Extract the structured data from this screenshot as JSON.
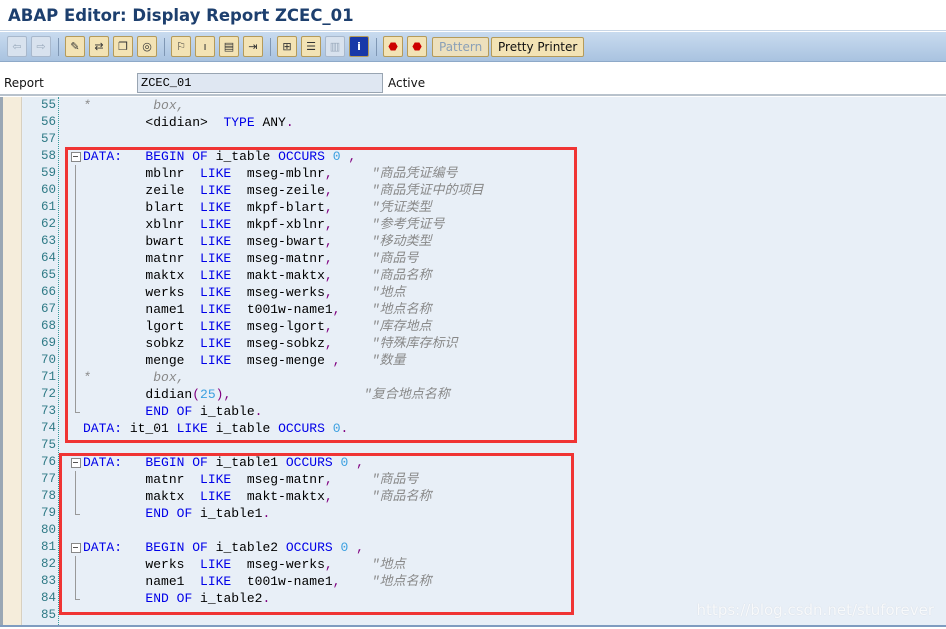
{
  "window": {
    "title": "ABAP Editor: Display Report ZCEC_01"
  },
  "toolbar": {
    "icons": [
      "back-icon",
      "forward-icon",
      "edit-toggle-icon",
      "active-inactive-icon",
      "other-object-icon",
      "check-icon",
      "activate-icon",
      "where-used-icon",
      "display-object-list-icon",
      "navigation-window-icon",
      "hierarchy-icon",
      "enhance-icon",
      "split-screen-icon",
      "info-icon",
      "set-breakpoint-icon",
      "set-session-breakpoint-icon"
    ],
    "pattern_label": "Pattern",
    "pretty_printer_label": "Pretty Printer"
  },
  "report": {
    "label": "Report",
    "value": "ZCEC_01",
    "status": "Active"
  },
  "editor": {
    "lines": [
      {
        "n": "55",
        "f": "",
        "t": [
          [
            "s",
            "*        box,"
          ]
        ]
      },
      {
        "n": "56",
        "f": "",
        "t": [
          [
            "i",
            "        <didian>  "
          ],
          [
            "k",
            "TYPE"
          ],
          [
            "i",
            " ANY"
          ],
          [
            "p",
            "."
          ]
        ]
      },
      {
        "n": "57",
        "f": "",
        "t": []
      },
      {
        "n": "58",
        "f": "open",
        "t": [
          [
            "k",
            "DATA:"
          ],
          [
            "i",
            "   "
          ],
          [
            "k",
            "BEGIN"
          ],
          [
            "i",
            " "
          ],
          [
            "k",
            "OF"
          ],
          [
            "i",
            " i_table "
          ],
          [
            "k",
            "OCCURS"
          ],
          [
            "i",
            " "
          ],
          [
            "n",
            "0"
          ],
          [
            "i",
            " "
          ],
          [
            "p",
            ","
          ]
        ]
      },
      {
        "n": "59",
        "f": "bar",
        "t": [
          [
            "i",
            "        mblnr  "
          ],
          [
            "k",
            "LIKE"
          ],
          [
            "i",
            "  mseg-mblnr"
          ],
          [
            "p",
            ","
          ],
          [
            "i",
            "     "
          ],
          [
            "c",
            "\"商品凭证编号"
          ]
        ]
      },
      {
        "n": "60",
        "f": "bar",
        "t": [
          [
            "i",
            "        zeile  "
          ],
          [
            "k",
            "LIKE"
          ],
          [
            "i",
            "  mseg-zeile"
          ],
          [
            "p",
            ","
          ],
          [
            "i",
            "     "
          ],
          [
            "c",
            "\"商品凭证中的项目"
          ]
        ]
      },
      {
        "n": "61",
        "f": "bar",
        "t": [
          [
            "i",
            "        blart  "
          ],
          [
            "k",
            "LIKE"
          ],
          [
            "i",
            "  mkpf-blart"
          ],
          [
            "p",
            ","
          ],
          [
            "i",
            "     "
          ],
          [
            "c",
            "\"凭证类型"
          ]
        ]
      },
      {
        "n": "62",
        "f": "bar",
        "t": [
          [
            "i",
            "        xblnr  "
          ],
          [
            "k",
            "LIKE"
          ],
          [
            "i",
            "  mkpf-xblnr"
          ],
          [
            "p",
            ","
          ],
          [
            "i",
            "     "
          ],
          [
            "c",
            "\"参考凭证号"
          ]
        ]
      },
      {
        "n": "63",
        "f": "bar",
        "t": [
          [
            "i",
            "        bwart  "
          ],
          [
            "k",
            "LIKE"
          ],
          [
            "i",
            "  mseg-bwart"
          ],
          [
            "p",
            ","
          ],
          [
            "i",
            "     "
          ],
          [
            "c",
            "\"移动类型"
          ]
        ]
      },
      {
        "n": "64",
        "f": "bar",
        "t": [
          [
            "i",
            "        matnr  "
          ],
          [
            "k",
            "LIKE"
          ],
          [
            "i",
            "  mseg-matnr"
          ],
          [
            "p",
            ","
          ],
          [
            "i",
            "     "
          ],
          [
            "c",
            "\"商品号"
          ]
        ]
      },
      {
        "n": "65",
        "f": "bar",
        "t": [
          [
            "i",
            "        maktx  "
          ],
          [
            "k",
            "LIKE"
          ],
          [
            "i",
            "  makt-maktx"
          ],
          [
            "p",
            ","
          ],
          [
            "i",
            "     "
          ],
          [
            "c",
            "\"商品名称"
          ]
        ]
      },
      {
        "n": "66",
        "f": "bar",
        "t": [
          [
            "i",
            "        werks  "
          ],
          [
            "k",
            "LIKE"
          ],
          [
            "i",
            "  mseg-werks"
          ],
          [
            "p",
            ","
          ],
          [
            "i",
            "     "
          ],
          [
            "c",
            "\"地点"
          ]
        ]
      },
      {
        "n": "67",
        "f": "bar",
        "t": [
          [
            "i",
            "        name1  "
          ],
          [
            "k",
            "LIKE"
          ],
          [
            "i",
            "  t001w-name1"
          ],
          [
            "p",
            ","
          ],
          [
            "i",
            "    "
          ],
          [
            "c",
            "\"地点名称"
          ]
        ]
      },
      {
        "n": "68",
        "f": "bar",
        "t": [
          [
            "i",
            "        lgort  "
          ],
          [
            "k",
            "LIKE"
          ],
          [
            "i",
            "  mseg-lgort"
          ],
          [
            "p",
            ","
          ],
          [
            "i",
            "     "
          ],
          [
            "c",
            "\"库存地点"
          ]
        ]
      },
      {
        "n": "69",
        "f": "bar",
        "t": [
          [
            "i",
            "        sobkz  "
          ],
          [
            "k",
            "LIKE"
          ],
          [
            "i",
            "  mseg-sobkz"
          ],
          [
            "p",
            ","
          ],
          [
            "i",
            "     "
          ],
          [
            "c",
            "\"特殊库存标识"
          ]
        ]
      },
      {
        "n": "70",
        "f": "bar",
        "t": [
          [
            "i",
            "        menge  "
          ],
          [
            "k",
            "LIKE"
          ],
          [
            "i",
            "  mseg-menge "
          ],
          [
            "p",
            ","
          ],
          [
            "i",
            "    "
          ],
          [
            "c",
            "\"数量"
          ]
        ]
      },
      {
        "n": "71",
        "f": "bar",
        "t": [
          [
            "s",
            "*        box,"
          ]
        ]
      },
      {
        "n": "72",
        "f": "bar",
        "t": [
          [
            "i",
            "        didian"
          ],
          [
            "p",
            "("
          ],
          [
            "n",
            "25"
          ],
          [
            "p",
            ")"
          ],
          [
            "p",
            ","
          ],
          [
            "i",
            "                 "
          ],
          [
            "c",
            "\"复合地点名称"
          ]
        ]
      },
      {
        "n": "73",
        "f": "end",
        "t": [
          [
            "i",
            "        "
          ],
          [
            "k",
            "END"
          ],
          [
            "i",
            " "
          ],
          [
            "k",
            "OF"
          ],
          [
            "i",
            " i_table"
          ],
          [
            "p",
            "."
          ]
        ]
      },
      {
        "n": "74",
        "f": "",
        "t": [
          [
            "k",
            "DATA:"
          ],
          [
            "i",
            " it_01 "
          ],
          [
            "k",
            "LIKE"
          ],
          [
            "i",
            " i_table "
          ],
          [
            "k",
            "OCCURS"
          ],
          [
            "i",
            " "
          ],
          [
            "n",
            "0"
          ],
          [
            "p",
            "."
          ]
        ]
      },
      {
        "n": "75",
        "f": "",
        "t": []
      },
      {
        "n": "76",
        "f": "open",
        "t": [
          [
            "k",
            "DATA:"
          ],
          [
            "i",
            "   "
          ],
          [
            "k",
            "BEGIN"
          ],
          [
            "i",
            " "
          ],
          [
            "k",
            "OF"
          ],
          [
            "i",
            " i_table1 "
          ],
          [
            "k",
            "OCCURS"
          ],
          [
            "i",
            " "
          ],
          [
            "n",
            "0"
          ],
          [
            "i",
            " "
          ],
          [
            "p",
            ","
          ]
        ]
      },
      {
        "n": "77",
        "f": "bar",
        "t": [
          [
            "i",
            "        matnr  "
          ],
          [
            "k",
            "LIKE"
          ],
          [
            "i",
            "  mseg-matnr"
          ],
          [
            "p",
            ","
          ],
          [
            "i",
            "     "
          ],
          [
            "c",
            "\"商品号"
          ]
        ]
      },
      {
        "n": "78",
        "f": "bar",
        "t": [
          [
            "i",
            "        maktx  "
          ],
          [
            "k",
            "LIKE"
          ],
          [
            "i",
            "  makt-maktx"
          ],
          [
            "p",
            ","
          ],
          [
            "i",
            "     "
          ],
          [
            "c",
            "\"商品名称"
          ]
        ]
      },
      {
        "n": "79",
        "f": "end",
        "t": [
          [
            "i",
            "        "
          ],
          [
            "k",
            "END"
          ],
          [
            "i",
            " "
          ],
          [
            "k",
            "OF"
          ],
          [
            "i",
            " i_table1"
          ],
          [
            "p",
            "."
          ]
        ]
      },
      {
        "n": "80",
        "f": "",
        "t": []
      },
      {
        "n": "81",
        "f": "open",
        "t": [
          [
            "k",
            "DATA:"
          ],
          [
            "i",
            "   "
          ],
          [
            "k",
            "BEGIN"
          ],
          [
            "i",
            " "
          ],
          [
            "k",
            "OF"
          ],
          [
            "i",
            " i_table2 "
          ],
          [
            "k",
            "OCCURS"
          ],
          [
            "i",
            " "
          ],
          [
            "n",
            "0"
          ],
          [
            "i",
            " "
          ],
          [
            "p",
            ","
          ]
        ]
      },
      {
        "n": "82",
        "f": "bar",
        "t": [
          [
            "i",
            "        werks  "
          ],
          [
            "k",
            "LIKE"
          ],
          [
            "i",
            "  mseg-werks"
          ],
          [
            "p",
            ","
          ],
          [
            "i",
            "     "
          ],
          [
            "c",
            "\"地点"
          ]
        ]
      },
      {
        "n": "83",
        "f": "bar",
        "t": [
          [
            "i",
            "        name1  "
          ],
          [
            "k",
            "LIKE"
          ],
          [
            "i",
            "  t001w-name1"
          ],
          [
            "p",
            ","
          ],
          [
            "i",
            "    "
          ],
          [
            "c",
            "\"地点名称"
          ]
        ]
      },
      {
        "n": "84",
        "f": "end",
        "t": [
          [
            "i",
            "        "
          ],
          [
            "k",
            "END"
          ],
          [
            "i",
            " "
          ],
          [
            "k",
            "OF"
          ],
          [
            "i",
            " i_table2"
          ],
          [
            "p",
            "."
          ]
        ]
      },
      {
        "n": "85",
        "f": "",
        "t": []
      }
    ]
  },
  "highlight_color": "#f03434",
  "watermark": "https://blog.csdn.net/stuforever"
}
